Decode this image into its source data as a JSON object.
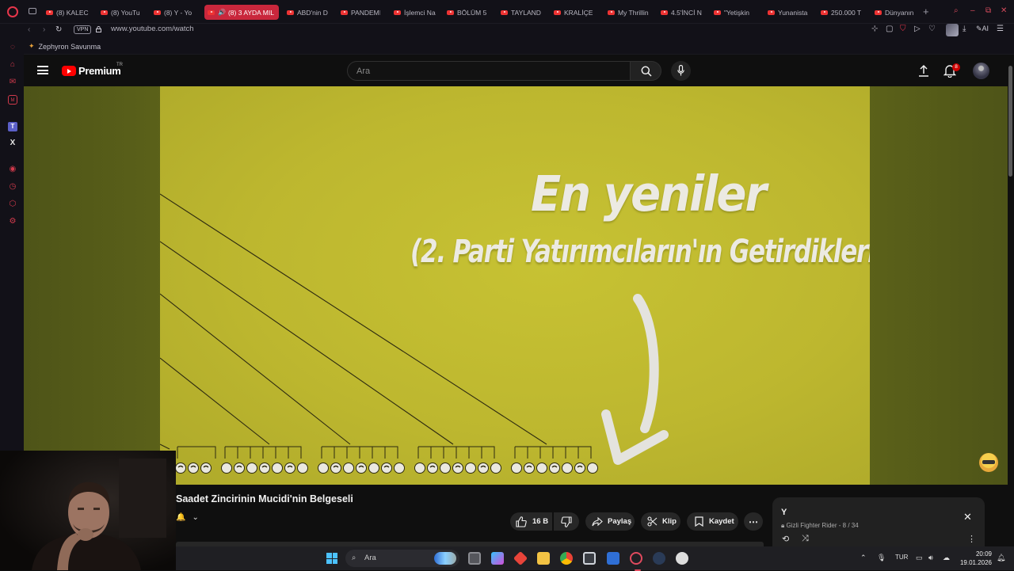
{
  "browser": {
    "tabs": [
      {
        "label": "(8) KALEC",
        "active": false
      },
      {
        "label": "(8) YouTu",
        "active": false
      },
      {
        "label": "(8) Y - Yo",
        "active": false
      },
      {
        "label": "(8) 3 AYDA MIL",
        "active": true
      },
      {
        "label": "ABD'nin D",
        "active": false
      },
      {
        "label": "PANDEMI",
        "active": false
      },
      {
        "label": "İşlemci Na",
        "active": false
      },
      {
        "label": "BÖLÜM 5",
        "active": false
      },
      {
        "label": "TAYLAND",
        "active": false
      },
      {
        "label": "KRALİÇE",
        "active": false
      },
      {
        "label": "My Thrillin",
        "active": false
      },
      {
        "label": "4.5'İNCİ N",
        "active": false
      },
      {
        "label": "\"Yetişkin",
        "active": false
      },
      {
        "label": "Yunanista",
        "active": false
      },
      {
        "label": "250.000 T",
        "active": false
      },
      {
        "label": "Dünyanın",
        "active": false
      }
    ],
    "vpn_label": "VPN",
    "url": "www.youtube.com/watch",
    "ai_label": "AI",
    "bookmark": "Zephyron Savunma"
  },
  "youtube": {
    "brand": "Premium",
    "region": "TR",
    "search_placeholder": "Ara",
    "notification_count": "8",
    "video_overlay": {
      "line1": "En yeniler",
      "line2": "(2. Parti Yatırımcıların'ın Getirdikleri)"
    },
    "video_title": "Saadet Zincirinin Mucidi'nin Belgeseli",
    "actions": {
      "likes": "16 B",
      "share": "Paylaş",
      "clip": "Klip",
      "save": "Kaydet"
    },
    "playlist": {
      "title": "Y",
      "privacy": "Gizli",
      "meta": "Fighter Rider - 8 / 34"
    }
  },
  "taskbar": {
    "search_placeholder": "Ara",
    "language": "TUR",
    "time": "20:09",
    "date": "19.01.2026"
  },
  "colors": {
    "youtube_red": "#ff0000",
    "opera_red": "#e6364b",
    "video_yellow": "#c7c233"
  }
}
